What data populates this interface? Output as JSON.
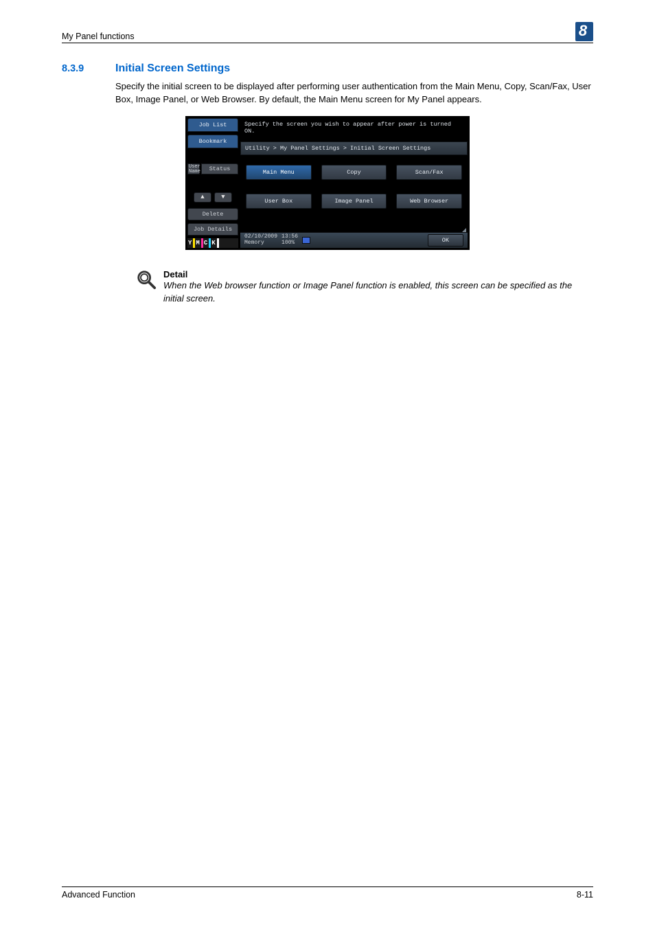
{
  "header": {
    "running_head": "My Panel functions",
    "chapter_number": "8"
  },
  "section": {
    "number": "8.3.9",
    "title": "Initial Screen Settings",
    "paragraph": "Specify the initial screen to be displayed after performing user authentication from the Main Menu, Copy, Scan/Fax, User Box, Image Panel, or Web Browser. By default, the Main Menu screen for My Panel appears."
  },
  "device": {
    "side": {
      "job_list": "Job List",
      "bookmark": "Bookmark",
      "list_icon_label": "User\nName",
      "status_tab": "Status",
      "delete": "Delete",
      "job_details": "Job Details",
      "ymck": {
        "y": "Y",
        "m": "M",
        "c": "C",
        "k": "K"
      }
    },
    "instruction": "Specify the screen you wish to appear after power is turned ON.",
    "breadcrumb": "Utility > My Panel Settings > Initial Screen Settings",
    "options": {
      "main_menu": "Main Menu",
      "copy": "Copy",
      "scan_fax": "Scan/Fax",
      "user_box": "User Box",
      "image_panel": "Image Panel",
      "web_browser": "Web Browser"
    },
    "footer": {
      "date": "02/10/2009",
      "time": "13:56",
      "memory_label": "Memory",
      "memory_value": "100%",
      "ok": "OK"
    }
  },
  "note": {
    "title": "Detail",
    "body": "When the Web browser function or Image Panel function is enabled, this screen can be specified as the initial screen."
  },
  "page_footer": {
    "left": "Advanced Function",
    "right": "8-11"
  }
}
